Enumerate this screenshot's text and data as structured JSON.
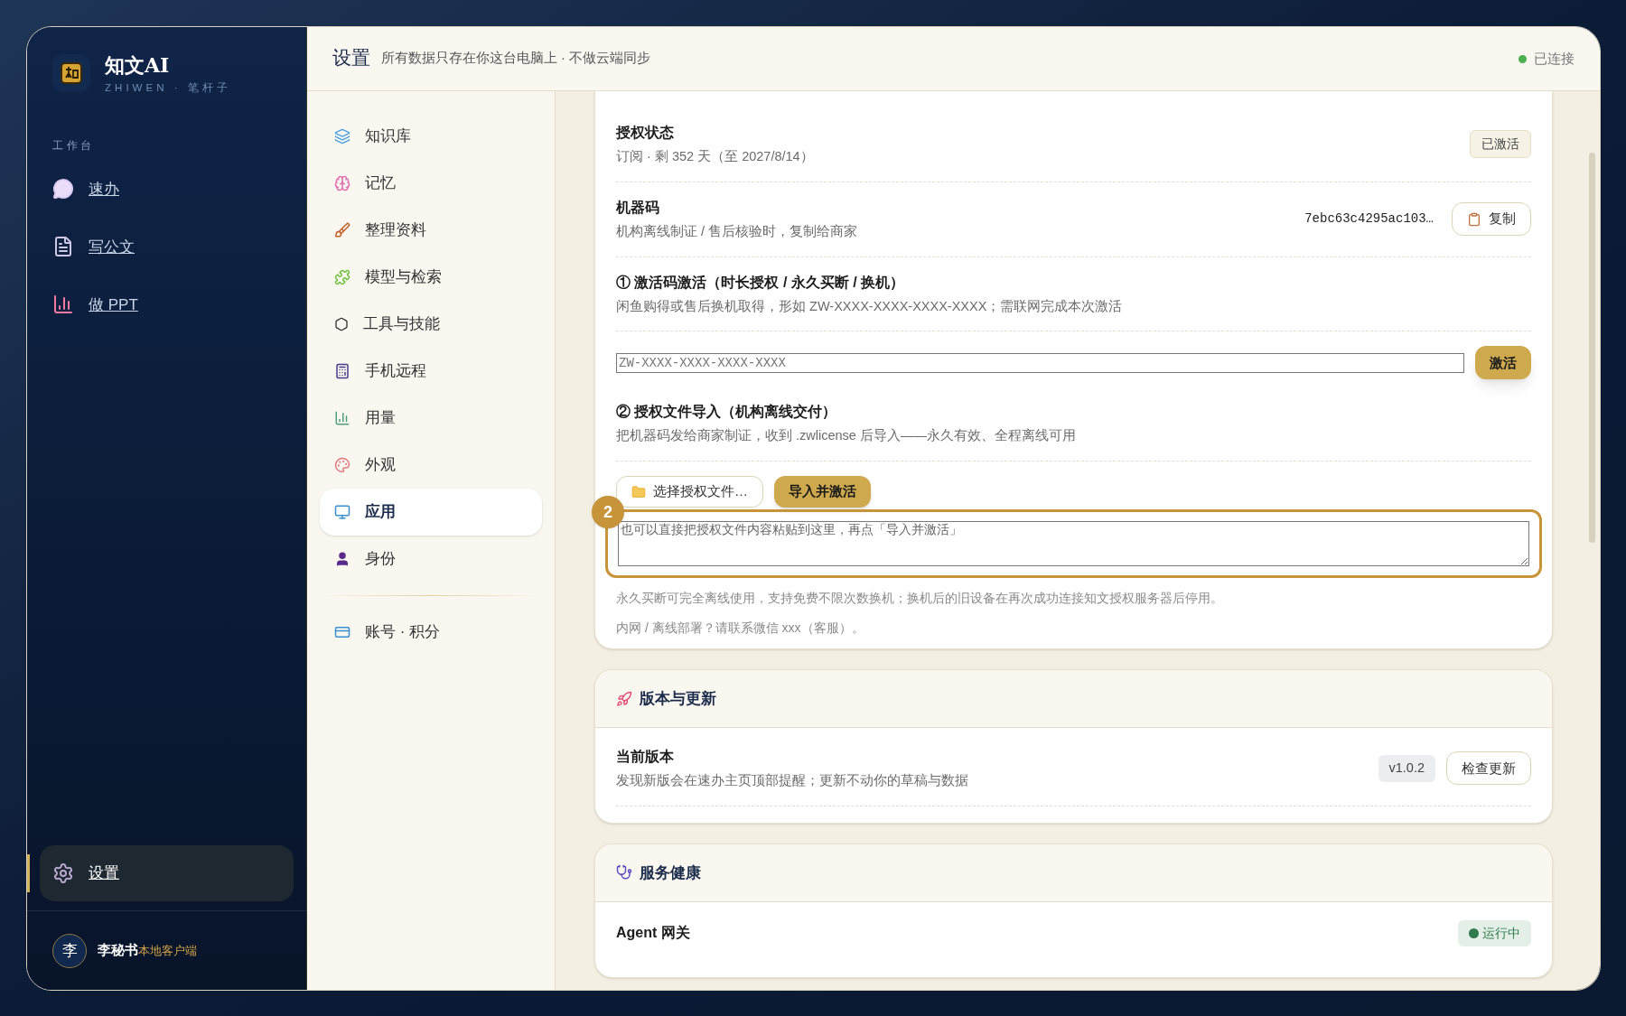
{
  "app": {
    "name": "知文AI",
    "subtitle": "ZHIWEN · 笔杆子"
  },
  "sidebar": {
    "section": "工作台",
    "items": [
      {
        "label": "速办",
        "selected": false
      },
      {
        "label": "写公文",
        "selected": false
      },
      {
        "label": "做 PPT",
        "selected": false
      }
    ],
    "bottom_items": [
      {
        "label": "设置",
        "selected": true
      }
    ],
    "user": {
      "avatar": "李",
      "name": "李秘书",
      "tag": "本地客户端"
    }
  },
  "header": {
    "title": "设置",
    "subtitle": "所有数据只存在你这台电脑上 · 不做云端同步",
    "status": {
      "label": "已连接",
      "online": true
    }
  },
  "settings_nav": {
    "items": [
      {
        "label": "知识库",
        "selected": false
      },
      {
        "label": "记忆",
        "selected": false
      },
      {
        "label": "整理资料",
        "selected": false
      },
      {
        "label": "模型与检索",
        "selected": false
      },
      {
        "label": "工具与技能",
        "selected": false
      },
      {
        "label": "手机远程",
        "selected": false
      },
      {
        "label": "用量",
        "selected": false
      },
      {
        "label": "外观",
        "selected": false
      },
      {
        "label": "应用",
        "selected": true
      },
      {
        "label": "身份",
        "selected": false
      }
    ],
    "footer_items": [
      {
        "label": "账号 · 积分",
        "selected": false
      }
    ]
  },
  "license_card": {
    "rows": [
      {
        "kind": "status",
        "title": "授权状态",
        "description": "订阅 · 剩 352 天（至 2027/8/14）",
        "badge": "已激活"
      },
      {
        "kind": "machine",
        "title": "机器码",
        "description": "机构离线制证 / 售后核验时，复制给商家",
        "code": "7ebc63c4295ac103…",
        "button": "复制"
      },
      {
        "kind": "heading",
        "title": "① 激活码激活（时长授权 / 永久买断 / 换机）",
        "description": "闲鱼购得或售后换机取得，形如 ZW-XXXX-XXXX-XXXX-XXXX；需联网完成本次激活"
      },
      {
        "kind": "code_input",
        "placeholder": "ZW-XXXX-XXXX-XXXX-XXXX",
        "button": "激活"
      },
      {
        "kind": "heading",
        "title": "② 授权文件导入（机构离线交付）",
        "description": "把机器码发给商家制证，收到 .zwlicense 后导入——永久有效、全程离线可用"
      },
      {
        "kind": "file_import",
        "choose_button": "选择授权文件…",
        "import_button": "导入并激活",
        "placeholder": "也可以直接把授权文件内容粘贴到这里，再点「导入并激活」",
        "callout": "2"
      }
    ],
    "notes": [
      "永久买断可完全离线使用，支持免费不限次数换机；换机后的旧设备在再次成功连接知文授权服务器后停用。",
      "内网 / 离线部署？请联系微信 xxx（客服）。"
    ]
  },
  "version_card": {
    "title": "版本与更新",
    "rows": [
      {
        "title": "当前版本",
        "description": "发现新版会在速办主页顶部提醒；更新不动你的草稿与数据",
        "badge": "v1.0.2",
        "button": "检查更新"
      }
    ]
  },
  "health_card": {
    "title": "服务健康",
    "rows": [
      {
        "title": "Agent 网关",
        "status": "运行中",
        "color": "#2f7a4f"
      }
    ]
  }
}
